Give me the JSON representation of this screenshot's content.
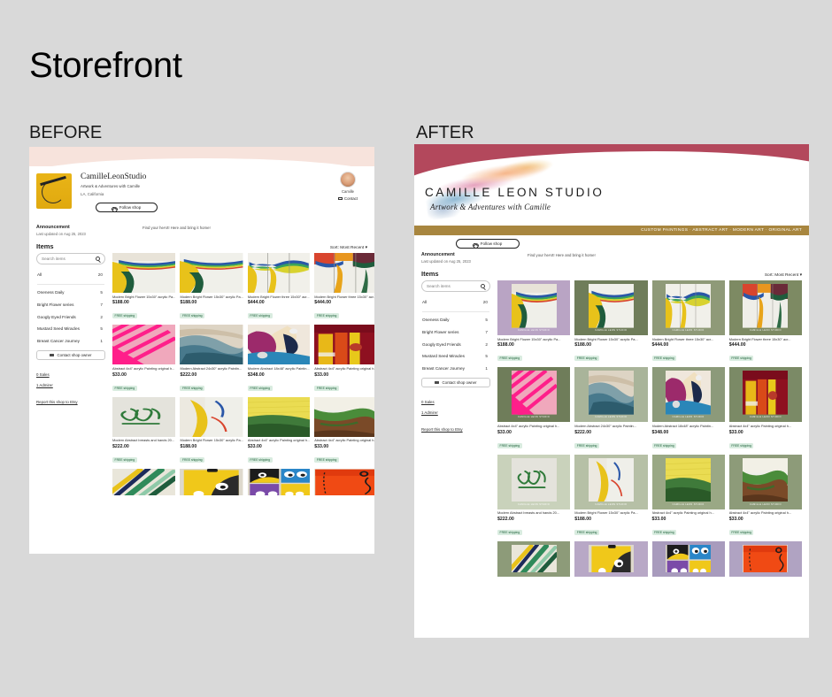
{
  "slide": {
    "title": "Storefront",
    "before_label": "BEFORE",
    "after_label": "AFTER"
  },
  "colors": {
    "slide_background": "#d9d9d9",
    "before_hero": "#f7e3dc",
    "after_wave": "#b3485c",
    "after_gold_bar": "#a8863f",
    "free_shipping_badge": "#d9ece0",
    "free_shipping_text": "#1a5e36"
  },
  "before": {
    "shop_name": "CamilleLeonStudio",
    "tagline": "Artwork & Adventures with Camille",
    "location": "LA, California",
    "follow_button": "Follow shop",
    "owner_name": "Camille",
    "contact_link": "Contact",
    "announcement_title": "Announcement",
    "announcement_updated": "Last updated on Aug 25, 2023",
    "announcement_message": "Find your heArt! Here and bring it home!",
    "items_heading": "Items",
    "sort_label": "Sort: Most Recent"
  },
  "after": {
    "logo_title": "CAMILLE LEON STUDIO",
    "logo_subtitle": "Artwork & Adventures with Camille",
    "gold_bar_text": "CUSTOM PAINTINGS · ABSTRACT ART · MODERN ART · ORIGINAL ART",
    "follow_button": "Follow shop",
    "announcement_title": "Announcement",
    "announcement_updated": "Last updated on Aug 25, 2023",
    "announcement_message": "Find your heArt! Here and bring it home!",
    "items_heading": "Items",
    "sort_label": "Sort: Most Recent",
    "watermark": "CAMILLE LEON STUDIO"
  },
  "sidebar": {
    "search_placeholder": "Search items",
    "categories": [
      {
        "label": "All",
        "count": "20"
      },
      {
        "label": "Oneness Daily",
        "count": "5"
      },
      {
        "label": "Bright Flower series",
        "count": "7"
      },
      {
        "label": "Googly Eyed Friends",
        "count": "2"
      },
      {
        "label": "Mustard Seed Miracles",
        "count": "5"
      },
      {
        "label": "Breast Cancer Journey",
        "count": "1"
      }
    ],
    "contact_owner": "Contact shop owner",
    "sales": "0 Sales",
    "admirers": "1 Admirer",
    "report": "Report this shop to Etsy"
  },
  "products": [
    {
      "title": "Modern Bright Flower 15x30\" acrylic Pa...",
      "price": "$188.00",
      "shipping": "FREE shipping",
      "art": "flower1",
      "bg": "#b9a4c4"
    },
    {
      "title": "Modern Bright Flower 15x30\" acrylic Pa...",
      "price": "$188.00",
      "shipping": "FREE shipping",
      "art": "flower2",
      "bg": "#6f7d5a"
    },
    {
      "title": "Modern Bright Flower three 15x30\" acr...",
      "price": "$444.00",
      "shipping": "FREE shipping",
      "art": "triptych1",
      "bg": "#8f9a78"
    },
    {
      "title": "Modern Bright Flower three 15x30\" acr...",
      "price": "$444.00",
      "shipping": "FREE shipping",
      "art": "triptych2",
      "bg": "#7d8a63"
    },
    {
      "title": "Abstract 4x4\" acrylic Painting original h...",
      "price": "$33.00",
      "shipping": "FREE shipping",
      "art": "pinkstripe",
      "bg": "#6f7d5a"
    },
    {
      "title": "Modern Abstract 24x30\" acrylic Paintin...",
      "price": "$222.00",
      "shipping": "FREE shipping",
      "art": "bluewave",
      "bg": "#a9b49a"
    },
    {
      "title": "Modern Abstract 18x48\" acrylic Paintin...",
      "price": "$348.00",
      "shipping": "FREE shipping",
      "art": "magenta",
      "bg": "#8c9a7a"
    },
    {
      "title": "Abstract 4x4\" acrylic Painting original h...",
      "price": "$33.00",
      "shipping": "FREE shipping",
      "art": "redyellow",
      "bg": "#7b8a66"
    },
    {
      "title": "Modern Abstract breasts and hands 20...",
      "price": "$222.00",
      "shipping": "FREE shipping",
      "art": "greenscript",
      "bg": "#c9d2bb"
    },
    {
      "title": "Modern Bright Flower 15x30\" acrylic Pa...",
      "price": "$188.00",
      "shipping": "FREE shipping",
      "art": "yellowblue",
      "bg": "#b6c0a6"
    },
    {
      "title": "Abstract 4x4\" acrylic Painting original h...",
      "price": "$33.00",
      "shipping": "FREE shipping",
      "art": "yellowgreen",
      "bg": "#9aa885"
    },
    {
      "title": "Abstract 4x4\" acrylic Painting original h...",
      "price": "$33.00",
      "shipping": "FREE shipping",
      "art": "earth",
      "bg": "#8d9b79"
    },
    {
      "title": "",
      "price": "",
      "shipping": "",
      "art": "greenblue",
      "bg": "#8d9b79"
    },
    {
      "title": "",
      "price": "",
      "shipping": "",
      "art": "googly1",
      "bg": "#b8a8c6"
    },
    {
      "title": "",
      "price": "",
      "shipping": "",
      "art": "googly2",
      "bg": "#a89bbd"
    },
    {
      "title": "",
      "price": "",
      "shipping": "",
      "art": "orange",
      "bg": "#b0a3c2"
    }
  ]
}
